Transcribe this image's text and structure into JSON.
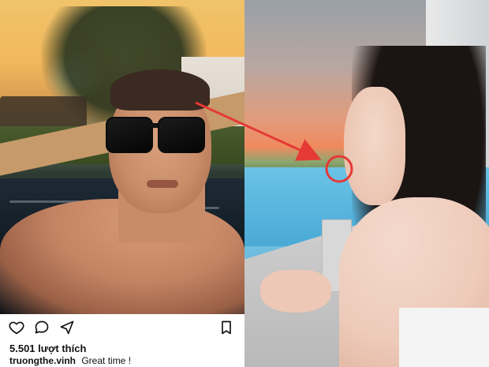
{
  "left_post": {
    "likes": "5.501 lượt thích",
    "caption_user": "truongthe.vinh",
    "caption_text": "Great time !"
  },
  "icons": {
    "like": "heart-icon",
    "comment": "comment-icon",
    "share": "send-icon",
    "save": "bookmark-icon"
  },
  "colors": {
    "annotation": "#e53935",
    "icon_stroke": "#111111"
  }
}
